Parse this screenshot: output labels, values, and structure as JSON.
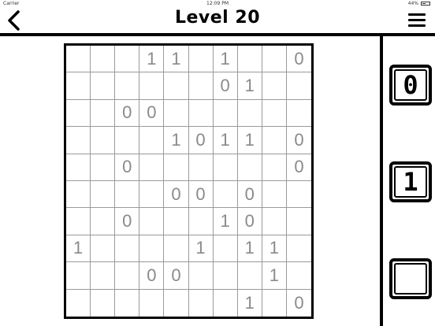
{
  "status_bar": {
    "carrier": "Carrier",
    "time": "12:09 PM",
    "battery": "44%"
  },
  "header": {
    "title": "Level 20"
  },
  "board": {
    "rows": [
      [
        "",
        "",
        "",
        "1",
        "1",
        "",
        "1",
        "",
        "",
        "0"
      ],
      [
        "",
        "",
        "",
        "",
        "",
        "",
        "0",
        "1",
        "",
        ""
      ],
      [
        "",
        "",
        "0",
        "0",
        "",
        "",
        "",
        "",
        "",
        ""
      ],
      [
        "",
        "",
        "",
        "",
        "1",
        "0",
        "1",
        "1",
        "",
        "0"
      ],
      [
        "",
        "",
        "0",
        "",
        "",
        "",
        "",
        "",
        "",
        "0"
      ],
      [
        "",
        "",
        "",
        "",
        "0",
        "0",
        "",
        "0",
        "",
        ""
      ],
      [
        "",
        "",
        "0",
        "",
        "",
        "",
        "1",
        "0",
        "",
        ""
      ],
      [
        "1",
        "",
        "",
        "",
        "",
        "1",
        "",
        "1",
        "1",
        ""
      ],
      [
        "",
        "",
        "",
        "0",
        "0",
        "",
        "",
        "",
        "1",
        ""
      ],
      [
        "",
        "",
        "",
        "",
        "",
        "",
        "",
        "1",
        "",
        "0"
      ]
    ]
  },
  "choices": [
    {
      "label": "0"
    },
    {
      "label": "1"
    },
    {
      "label": ""
    }
  ]
}
